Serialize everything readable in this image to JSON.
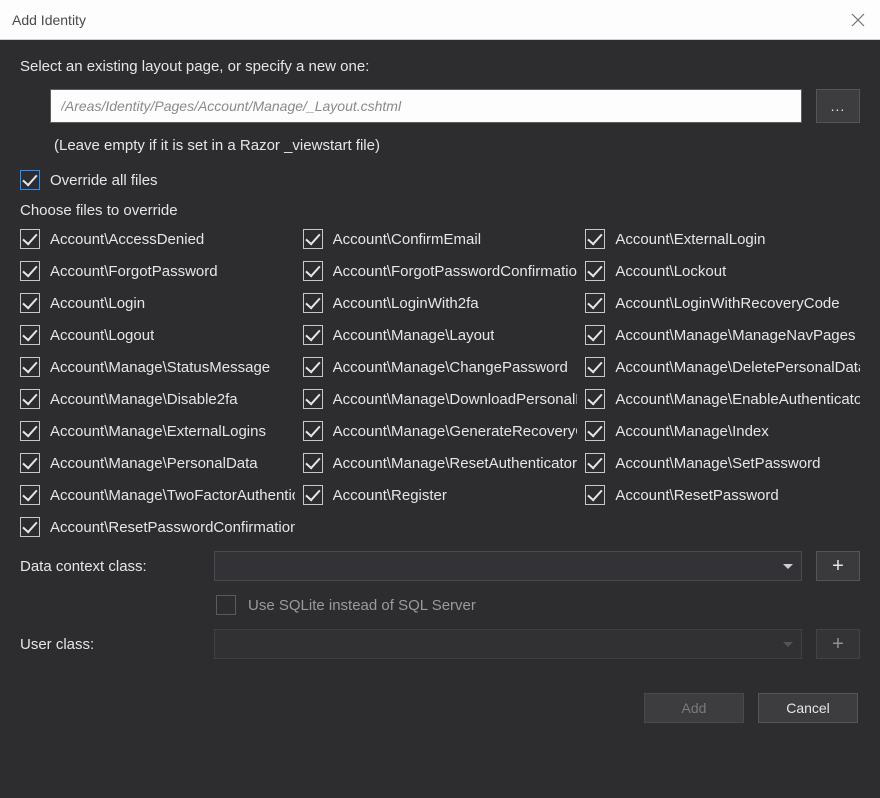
{
  "titlebar": {
    "title": "Add Identity"
  },
  "layout": {
    "instruction": "Select an existing layout page, or specify a new one:",
    "placeholder": "/Areas/Identity/Pages/Account/Manage/_Layout.cshtml",
    "browse_label": "...",
    "hint": "(Leave empty if it is set in a Razor _viewstart file)"
  },
  "overrideAll": {
    "label": "Override all files",
    "checked": true
  },
  "chooseLabel": "Choose files to override",
  "files": [
    {
      "label": "Account\\AccessDenied",
      "checked": true
    },
    {
      "label": "Account\\ConfirmEmail",
      "checked": true
    },
    {
      "label": "Account\\ExternalLogin",
      "checked": true
    },
    {
      "label": "Account\\ForgotPassword",
      "checked": true
    },
    {
      "label": "Account\\ForgotPasswordConfirmation",
      "checked": true
    },
    {
      "label": "Account\\Lockout",
      "checked": true
    },
    {
      "label": "Account\\Login",
      "checked": true
    },
    {
      "label": "Account\\LoginWith2fa",
      "checked": true
    },
    {
      "label": "Account\\LoginWithRecoveryCode",
      "checked": true
    },
    {
      "label": "Account\\Logout",
      "checked": true
    },
    {
      "label": "Account\\Manage\\Layout",
      "checked": true
    },
    {
      "label": "Account\\Manage\\ManageNavPages",
      "checked": true
    },
    {
      "label": "Account\\Manage\\StatusMessage",
      "checked": true
    },
    {
      "label": "Account\\Manage\\ChangePassword",
      "checked": true
    },
    {
      "label": "Account\\Manage\\DeletePersonalData",
      "checked": true
    },
    {
      "label": "Account\\Manage\\Disable2fa",
      "checked": true
    },
    {
      "label": "Account\\Manage\\DownloadPersonalData",
      "checked": true
    },
    {
      "label": "Account\\Manage\\EnableAuthenticator",
      "checked": true
    },
    {
      "label": "Account\\Manage\\ExternalLogins",
      "checked": true
    },
    {
      "label": "Account\\Manage\\GenerateRecoveryCodes",
      "checked": true
    },
    {
      "label": "Account\\Manage\\Index",
      "checked": true
    },
    {
      "label": "Account\\Manage\\PersonalData",
      "checked": true
    },
    {
      "label": "Account\\Manage\\ResetAuthenticator",
      "checked": true
    },
    {
      "label": "Account\\Manage\\SetPassword",
      "checked": true
    },
    {
      "label": "Account\\Manage\\TwoFactorAuthentication",
      "checked": true
    },
    {
      "label": "Account\\Register",
      "checked": true
    },
    {
      "label": "Account\\ResetPassword",
      "checked": true
    },
    {
      "label": "Account\\ResetPasswordConfirmation",
      "checked": true
    }
  ],
  "dataContext": {
    "label": "Data context class:",
    "plus": "+"
  },
  "sqlite": {
    "label": "Use SQLite instead of SQL Server",
    "checked": false,
    "disabled": true
  },
  "userClass": {
    "label": "User class:",
    "disabled": true,
    "plus": "+"
  },
  "footer": {
    "add": "Add",
    "cancel": "Cancel"
  }
}
